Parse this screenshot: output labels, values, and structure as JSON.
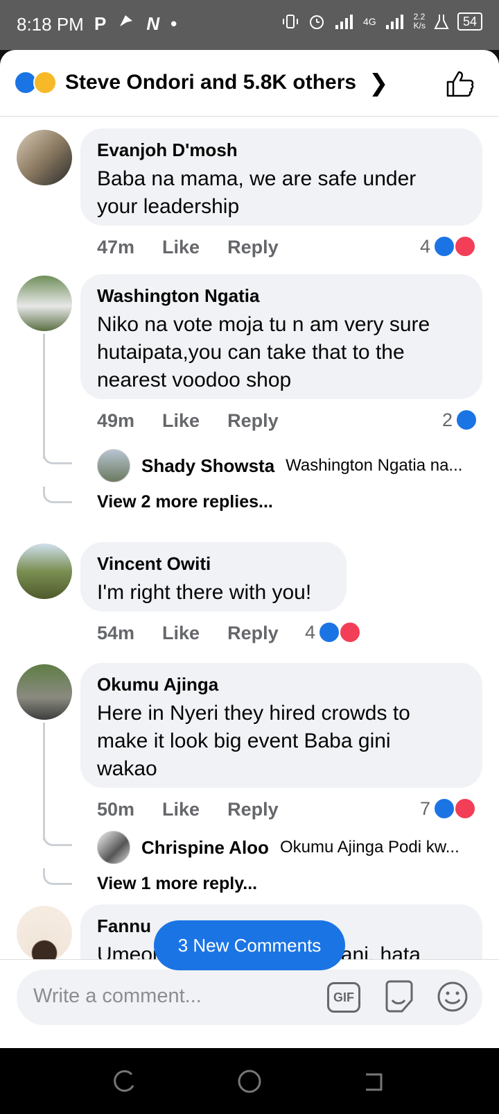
{
  "status_bar": {
    "time": "8:18 PM",
    "app_icons": [
      "P",
      "N"
    ],
    "network_speed": "2.2\nK/s",
    "network_type": "4G",
    "battery": "54"
  },
  "reactions_header": {
    "label": "Steve Ondori and 5.8K others",
    "reaction_icons": [
      "like-icon",
      "haha-icon"
    ]
  },
  "comments": [
    {
      "name": "Evanjoh D'mosh",
      "text_lines": [
        "Baba na mama, we are safe under",
        "your leadership"
      ],
      "time": "47m",
      "like_label": "Like",
      "reply_label": "Reply",
      "reaction_count": "4"
    },
    {
      "name": "Washington Ngatia",
      "text_lines": [
        "Niko na vote moja tu n am very sure",
        "hutaipata,you can take that to the",
        "nearest voodoo shop"
      ],
      "time": "49m",
      "like_label": "Like",
      "reply_label": "Reply",
      "reaction_count": "2",
      "reply_preview": {
        "name": "Shady Showsta",
        "text": "Washington Ngatia na..."
      },
      "more_replies": "View 2 more replies..."
    },
    {
      "name": "Vincent Owiti",
      "text_lines": [
        "I'm right there with you!"
      ],
      "time": "54m",
      "like_label": "Like",
      "reply_label": "Reply",
      "reaction_count": "4"
    },
    {
      "name": "Okumu Ajinga",
      "text_lines": [
        "Here in Nyeri they hired crowds to",
        "make it look big event Baba gini",
        "wakao"
      ],
      "time": "50m",
      "like_label": "Like",
      "reply_label": "Reply",
      "reaction_count": "7",
      "reply_preview": {
        "name": "Chrispine Aloo",
        "text": "Okumu Ajinga Podi kw..."
      },
      "more_replies": "View 1 more reply..."
    },
    {
      "name": "Fannu",
      "text_lines": [
        "Umeona shosh wa Ukambani, hata"
      ]
    }
  ],
  "new_comments_button": "3 New Comments",
  "composer": {
    "placeholder": "Write a comment...",
    "gif_label": "GIF"
  },
  "colors": {
    "brand_blue": "#1b74e4",
    "love_red": "#f33e58",
    "bubble_bg": "#f0f2f5",
    "meta_gray": "#65676b"
  }
}
